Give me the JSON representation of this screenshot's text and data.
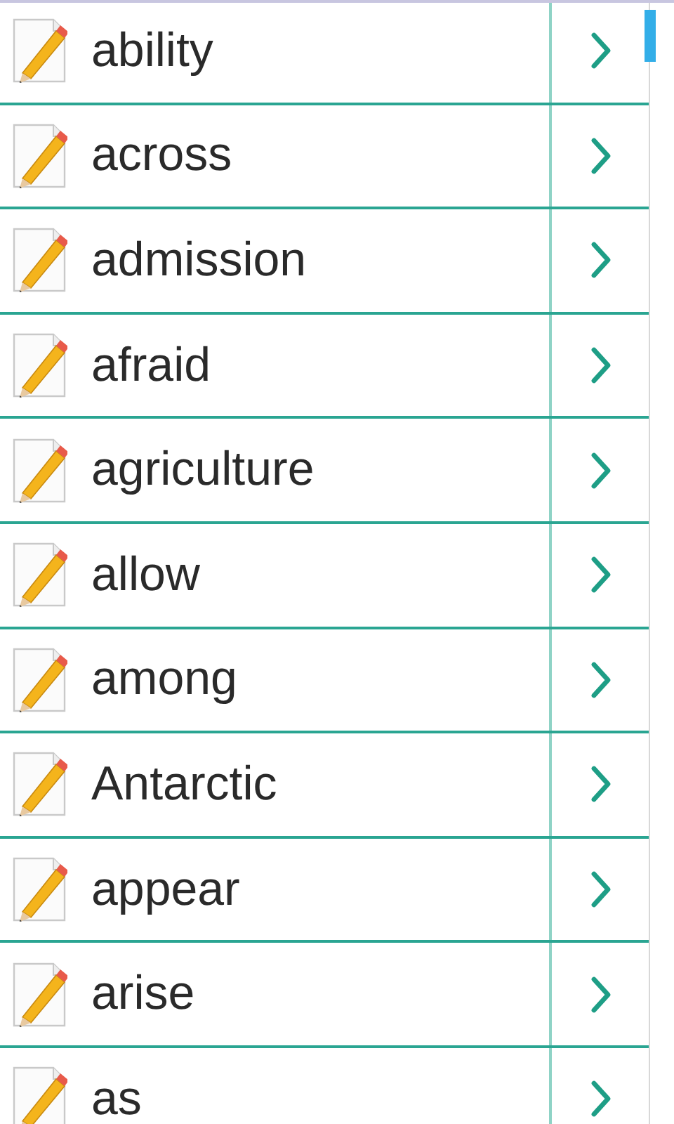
{
  "words": [
    {
      "word": "ability"
    },
    {
      "word": "across"
    },
    {
      "word": "admission"
    },
    {
      "word": "afraid"
    },
    {
      "word": "agriculture"
    },
    {
      "word": "allow"
    },
    {
      "word": "among"
    },
    {
      "word": "Antarctic"
    },
    {
      "word": "appear"
    },
    {
      "word": "arise"
    },
    {
      "word": "as"
    }
  ]
}
